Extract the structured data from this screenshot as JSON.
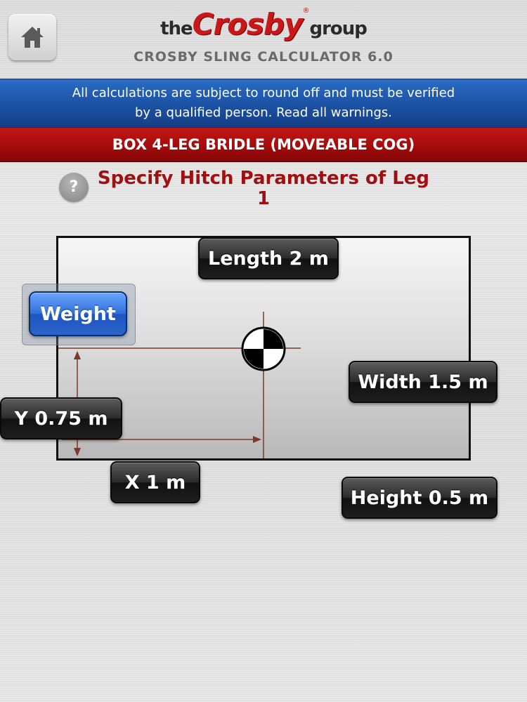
{
  "header": {
    "logo_the": "the",
    "logo_brand": "Crosby",
    "logo_reg": "®",
    "logo_group": "group",
    "app_title": "CROSBY SLING CALCULATOR 6.0",
    "home_icon": "home-icon"
  },
  "warning": {
    "line1": "All calculations are subject to round off and must be verified",
    "line2": "by a qualified person. Read all warnings."
  },
  "section_title": "BOX 4-LEG BRIDLE (MOVEABLE COG)",
  "help": {
    "label": "?"
  },
  "heading": {
    "line1": "Specify Hitch Parameters of Leg",
    "line2": "1"
  },
  "params": {
    "length_label": "Length 2 m",
    "weight_label": "Weight",
    "width_label": "Width 1.5 m",
    "y_label": "Y 0.75 m",
    "x_label": "X 1 m",
    "height_label": "Height 0.5 m"
  },
  "colors": {
    "accent_blue": "#1a4fa0",
    "accent_red": "#a40c0c",
    "heading_red": "#a01010",
    "dimension_line": "#7a3a2a"
  }
}
